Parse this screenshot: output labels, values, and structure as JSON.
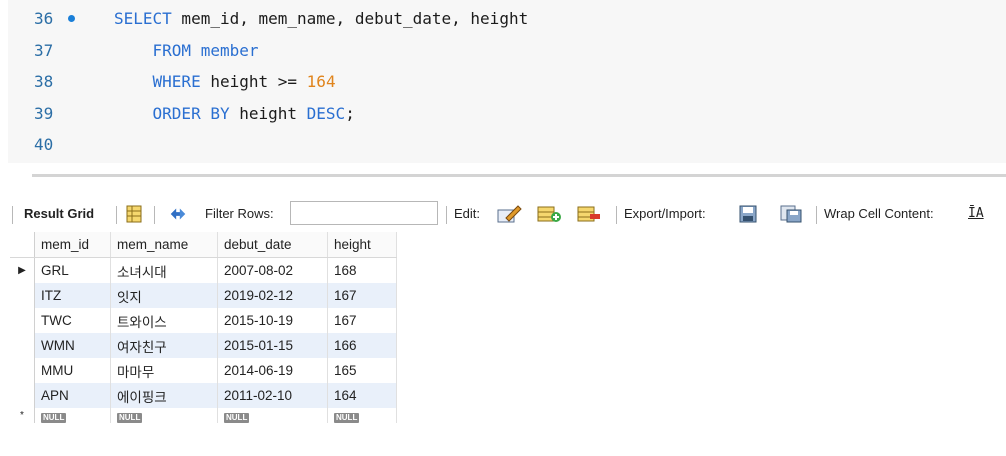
{
  "editor": {
    "lines": [
      {
        "num": "36",
        "tokens": [
          {
            "t": "SELECT",
            "k": "kw"
          },
          {
            "t": " mem_id, mem_name, debut_date, height",
            "k": ""
          }
        ]
      },
      {
        "num": "37",
        "tokens": [
          {
            "t": "    FROM",
            "k": "kw"
          },
          {
            "t": " member",
            "k": "kw"
          }
        ]
      },
      {
        "num": "38",
        "tokens": [
          {
            "t": "    WHERE",
            "k": "kw"
          },
          {
            "t": " height >= ",
            "k": ""
          },
          {
            "t": "164",
            "k": "num"
          }
        ]
      },
      {
        "num": "39",
        "tokens": [
          {
            "t": "    ORDER BY",
            "k": "kw"
          },
          {
            "t": " height ",
            "k": ""
          },
          {
            "t": "DESC",
            "k": "kw"
          },
          {
            "t": ";",
            "k": ""
          }
        ]
      },
      {
        "num": "40",
        "tokens": []
      }
    ]
  },
  "toolbar": {
    "result_grid": "Result Grid",
    "filter_rows": "Filter Rows:",
    "filter_value": "",
    "edit": "Edit:",
    "export_import": "Export/Import:",
    "wrap_cell": "Wrap Cell Content:",
    "wrap_icon_glyph": "ĪA"
  },
  "grid": {
    "columns": [
      "mem_id",
      "mem_name",
      "debut_date",
      "height"
    ],
    "rows": [
      [
        "GRL",
        "소녀시대",
        "2007-08-02",
        "168"
      ],
      [
        "ITZ",
        "잇지",
        "2019-02-12",
        "167"
      ],
      [
        "TWC",
        "트와이스",
        "2015-10-19",
        "167"
      ],
      [
        "WMN",
        "여자친구",
        "2015-01-15",
        "166"
      ],
      [
        "MMU",
        "마마무",
        "2014-06-19",
        "165"
      ],
      [
        "APN",
        "에이핑크",
        "2011-02-10",
        "164"
      ]
    ],
    "null_label": "NULL",
    "current_row_marker": "▶",
    "new_row_marker": "*"
  },
  "colors": {
    "keyword": "#2a6fd1",
    "number": "#e0841c",
    "line_number": "#2b6ea6",
    "row_alt": "#e9f0fa"
  }
}
